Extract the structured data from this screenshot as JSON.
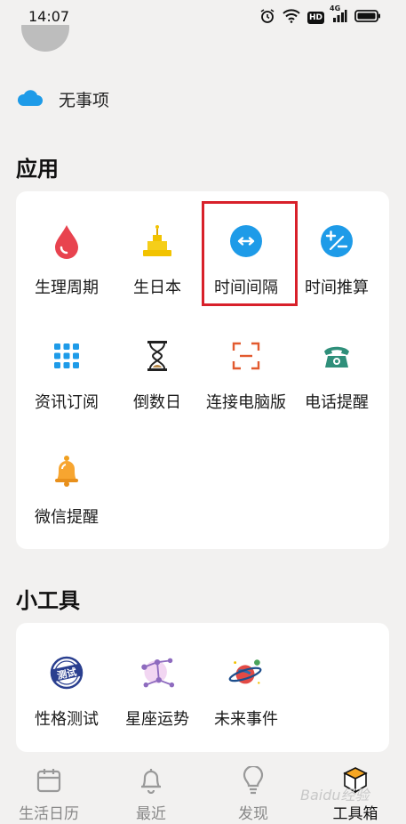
{
  "status_bar": {
    "time": "14:07",
    "network_label": "4G",
    "hd_label": "HD",
    "icons": [
      "alarm-icon",
      "wifi-icon",
      "hd-icon",
      "signal-icon",
      "battery-icon"
    ]
  },
  "weather": {
    "text": "无事项",
    "icon": "cloud-icon"
  },
  "apps_section": {
    "title": "应用",
    "items": [
      {
        "label": "生理周期",
        "icon": "blood-drop-icon"
      },
      {
        "label": "生日本",
        "icon": "birthday-cake-icon"
      },
      {
        "label": "时间间隔",
        "icon": "time-interval-icon"
      },
      {
        "label": "时间推算",
        "icon": "plus-minus-icon"
      },
      {
        "label": "资讯订阅",
        "icon": "grid-icon"
      },
      {
        "label": "倒数日",
        "icon": "hourglass-icon"
      },
      {
        "label": "连接电脑版",
        "icon": "scan-frame-icon"
      },
      {
        "label": "电话提醒",
        "icon": "telephone-icon"
      },
      {
        "label": "微信提醒",
        "icon": "bell-icon"
      }
    ]
  },
  "tools_section": {
    "title": "小工具",
    "items": [
      {
        "label": "性格测试",
        "icon": "test-stamp-icon",
        "stamp_text": "测试"
      },
      {
        "label": "星座运势",
        "icon": "constellation-icon"
      },
      {
        "label": "未来事件",
        "icon": "planet-icon"
      }
    ]
  },
  "bottom_nav": {
    "items": [
      {
        "label": "生活日历",
        "icon": "calendar-icon"
      },
      {
        "label": "最近",
        "icon": "bell-outline-icon"
      },
      {
        "label": "发现",
        "icon": "lightbulb-icon"
      },
      {
        "label": "工具箱",
        "icon": "toolbox-cube-icon",
        "active": true
      }
    ]
  },
  "watermark": "Baidu经验",
  "colors": {
    "accent_blue": "#1e9be8",
    "highlight_red": "#d8202a",
    "background": "#f2f1f0",
    "card": "#ffffff"
  }
}
